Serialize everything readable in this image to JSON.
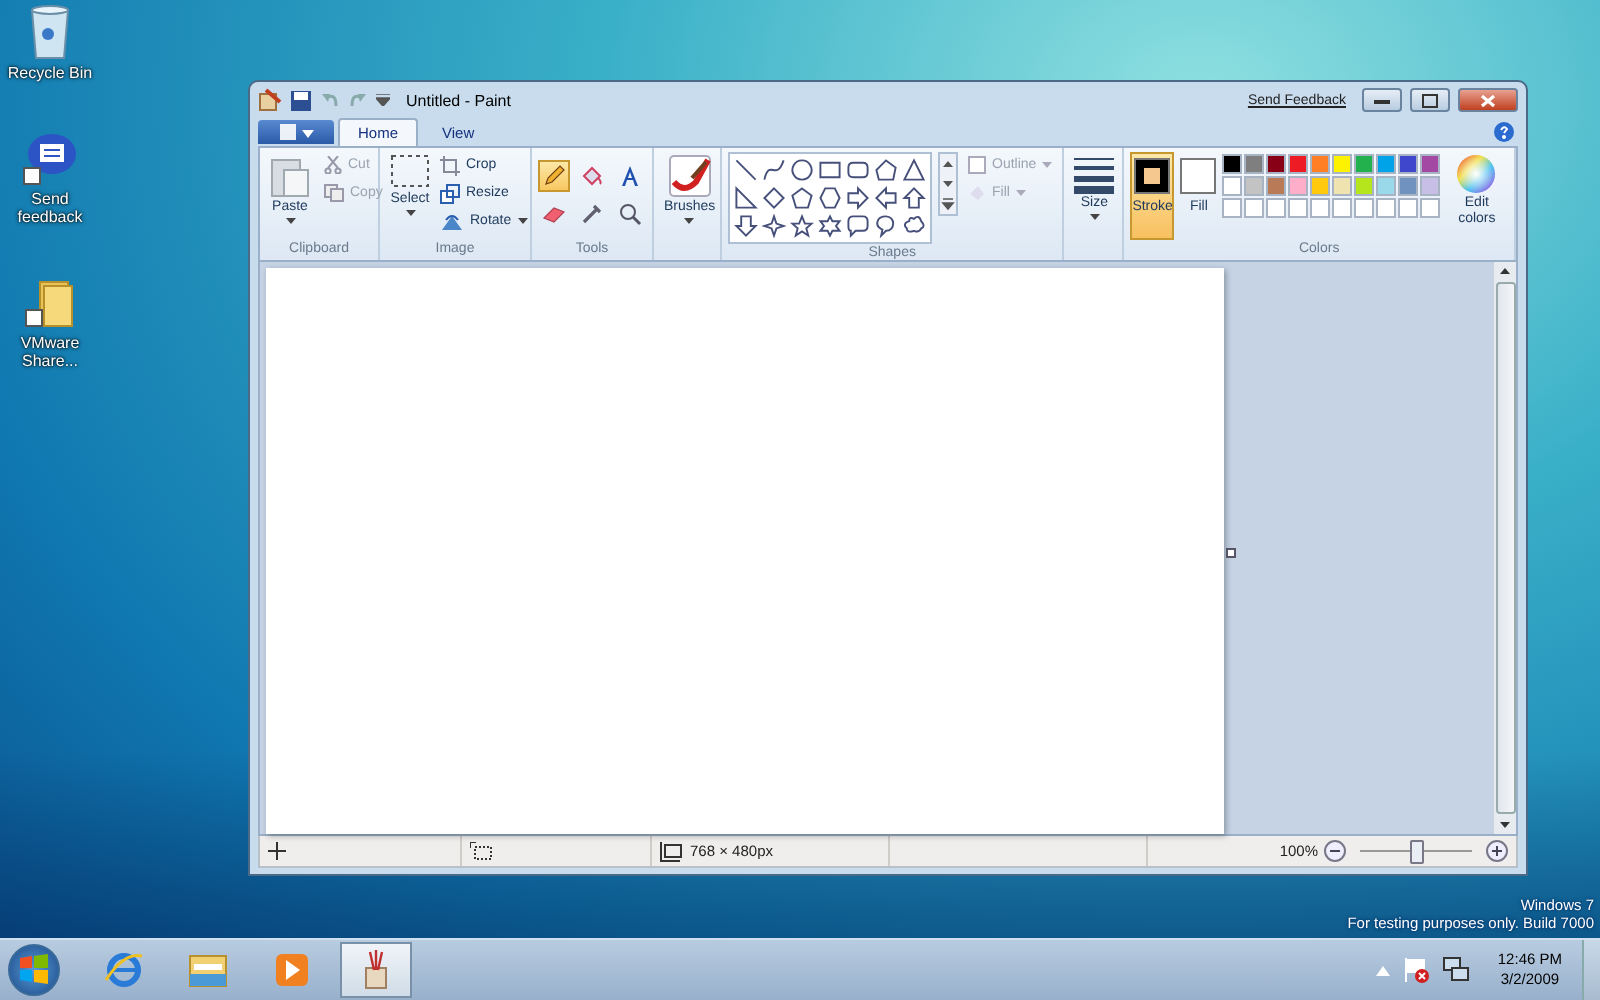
{
  "desktop_icons": [
    {
      "label": "Recycle Bin",
      "kind": "bin"
    },
    {
      "label": "Send feedback",
      "kind": "feedback"
    },
    {
      "label": "VMware Share...",
      "kind": "folder"
    }
  ],
  "window": {
    "title": "Untitled - Paint",
    "send_feedback": "Send Feedback",
    "tabs": [
      {
        "label": "Home",
        "selected": true
      },
      {
        "label": "View",
        "selected": false
      }
    ],
    "clipboard": {
      "label": "Clipboard",
      "paste": "Paste",
      "cut": {
        "label": "Cut",
        "disabled": true
      },
      "copy": {
        "label": "Copy",
        "disabled": true
      }
    },
    "image": {
      "label": "Image",
      "select": "Select",
      "crop": "Crop",
      "resize": "Resize",
      "rotate": "Rotate"
    },
    "tools": {
      "label": "Tools",
      "items": [
        {
          "kind": "pencil",
          "selected": true
        },
        {
          "kind": "fill",
          "selected": false
        },
        {
          "kind": "text",
          "selected": false
        },
        {
          "kind": "eraser",
          "selected": false
        },
        {
          "kind": "picker",
          "selected": false
        },
        {
          "kind": "magnifier",
          "selected": false
        }
      ]
    },
    "brushes": {
      "label": "Brushes"
    },
    "shapes": {
      "label": "Shapes",
      "outline": {
        "label": "Outline",
        "disabled": true
      },
      "fill": {
        "label": "Fill",
        "disabled": true
      }
    },
    "size": {
      "label": "Size"
    },
    "colors": {
      "label": "Colors",
      "stroke": {
        "label": "Stroke",
        "color": "#000000",
        "selected": true
      },
      "fill": {
        "label": "Fill",
        "color": "#ffffff",
        "selected": false
      },
      "edit": "Edit colors",
      "palette": [
        {
          "color": "#000000"
        },
        {
          "color": "#7f7f7f"
        },
        {
          "color": "#880015"
        },
        {
          "color": "#ed1c24"
        },
        {
          "color": "#ff7f27"
        },
        {
          "color": "#fff200"
        },
        {
          "color": "#22b14c"
        },
        {
          "color": "#00a2e8"
        },
        {
          "color": "#3f48cc"
        },
        {
          "color": "#a349a4"
        },
        {
          "color": "#ffffff"
        },
        {
          "color": "#c3c3c3"
        },
        {
          "color": "#b97a57"
        },
        {
          "color": "#ffaec9"
        },
        {
          "color": "#ffc90e"
        },
        {
          "color": "#efe4b0"
        },
        {
          "color": "#b5e61d"
        },
        {
          "color": "#99d9ea"
        },
        {
          "color": "#7092be"
        },
        {
          "color": "#c8bfe7"
        }
      ]
    },
    "status_bar": {
      "dimensions": "768 × 480px",
      "zoom": "100%",
      "level": 0.5
    }
  },
  "watermark": {
    "line_1": "Windows  7",
    "line_2": "For testing purposes only. Build 7000"
  },
  "taskbar": {
    "items": [
      {
        "kind": "ie",
        "selected": false
      },
      {
        "kind": "explorer",
        "selected": false
      },
      {
        "kind": "media",
        "selected": false
      },
      {
        "kind": "paint",
        "selected": true
      }
    ],
    "time": "12:46 PM",
    "date": "3/2/2009"
  }
}
